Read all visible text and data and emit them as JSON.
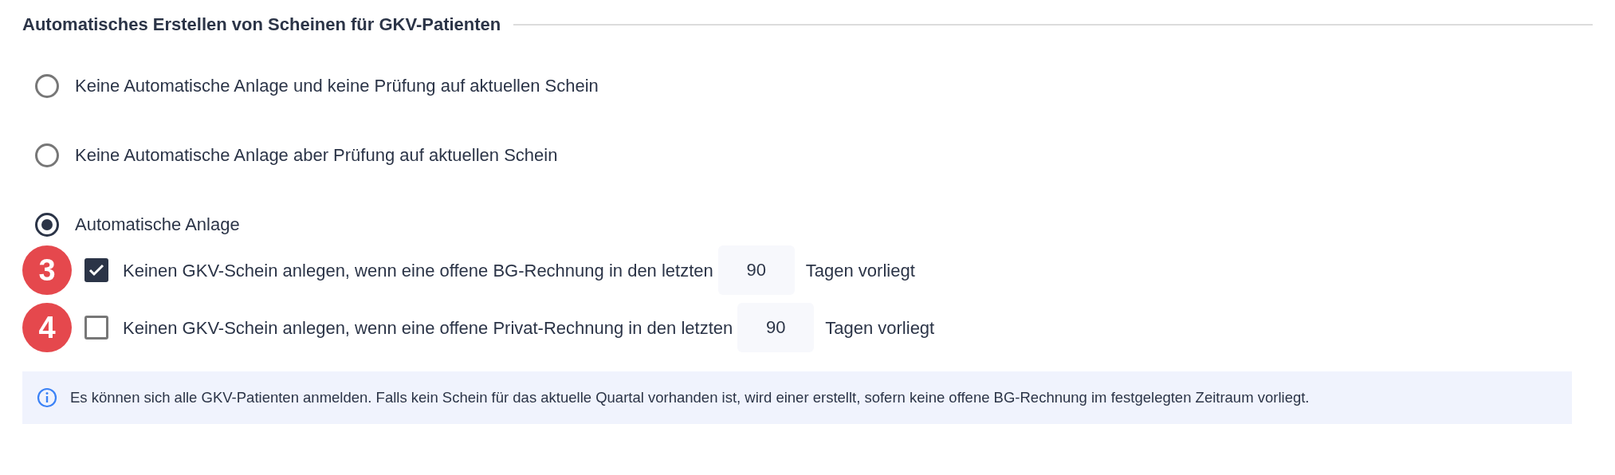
{
  "section": {
    "title": "Automatisches Erstellen von Scheinen für GKV-Patienten"
  },
  "options": [
    {
      "label": "Keine Automatische Anlage und keine Prüfung auf aktuellen Schein",
      "selected": false
    },
    {
      "label": "Keine Automatische Anlage aber Prüfung auf aktuellen Schein",
      "selected": false
    },
    {
      "label": "Automatische Anlage",
      "selected": true
    }
  ],
  "rules": [
    {
      "badge": "3",
      "checked": true,
      "label_before": "Keinen GKV-Schein anlegen, wenn eine offene BG-Rechnung in den letzten",
      "days": "90",
      "label_after": "Tagen vorliegt"
    },
    {
      "badge": "4",
      "checked": false,
      "label_before": "Keinen GKV-Schein anlegen, wenn eine offene Privat-Rechnung in den letzten",
      "days": "90",
      "label_after": "Tagen vorliegt"
    }
  ],
  "info": {
    "text": "Es können sich alle GKV-Patienten anmelden. Falls kein Schein für das aktuelle Quartal vorhanden ist, wird einer erstellt, sofern keine offene BG-Rechnung im festgelegten Zeitraum vorliegt."
  }
}
